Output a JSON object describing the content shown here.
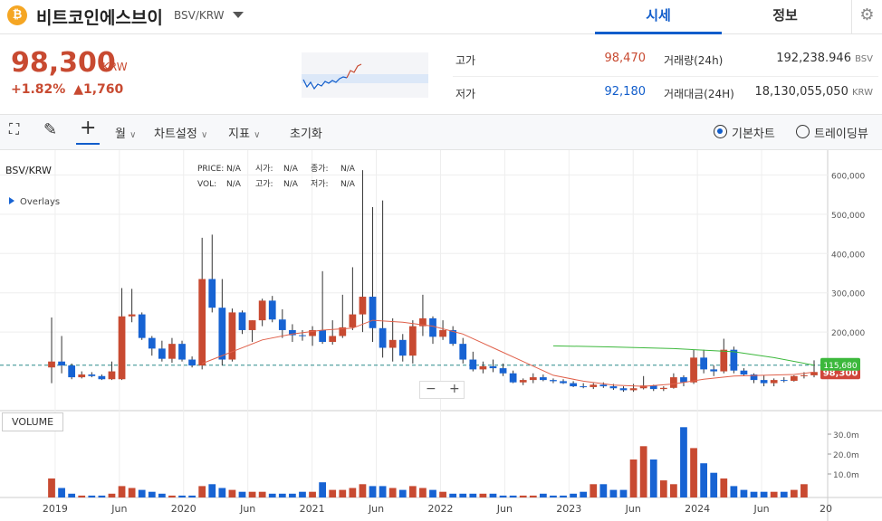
{
  "header": {
    "coin_icon": "₿",
    "coin_name": "비트코인에스브이",
    "pair": "BSV/KRW",
    "tabs": [
      {
        "label": "시세"
      },
      {
        "label": "정보"
      }
    ]
  },
  "price": {
    "current": "98,300",
    "unit": "KRW",
    "change_rate": "+1.82%",
    "change_amount": "▲1,760"
  },
  "stats": {
    "high_label": "고가",
    "high": "98,470",
    "low_label": "저가",
    "low": "92,180",
    "volume_label": "거래량(24h)",
    "volume": "192,238.946",
    "volume_unit": "BSV",
    "value_label": "거래대금(24H)",
    "value": "18,130,055,050",
    "value_unit": "KRW"
  },
  "toolbar": {
    "period": "월",
    "chart_settings": "차트설정",
    "indicators": "지표",
    "reset": "초기화",
    "basic_chart": "기본차트",
    "trading_view": "트레이딩뷰"
  },
  "chart_data": {
    "type": "candlestick",
    "title": "BSV/KRW",
    "overlays_label": "Overlays",
    "info": {
      "price_label": "PRICE:",
      "price": "N/A",
      "open_label": "시가:",
      "open": "N/A",
      "close_label": "종가:",
      "close": "N/A",
      "vol_label": "VOL:",
      "vol": "N/A",
      "high_label": "고가:",
      "high": "N/A",
      "low_label": "저가:",
      "low": "N/A"
    },
    "y_ticks": [
      "600,000",
      "500,000",
      "400,000",
      "300,000",
      "200,000"
    ],
    "y_values": [
      600000,
      500000,
      400000,
      300000,
      200000
    ],
    "ylim": [
      0,
      640000
    ],
    "x_ticks": [
      "Jun",
      "2019",
      "Jun",
      "2020",
      "Jun",
      "2021",
      "Jun",
      "2022",
      "Jun",
      "2023",
      "Jun",
      "2024",
      "Jun",
      "20"
    ],
    "volume_ticks": [
      "30.0m",
      "20.0m",
      "10.0m"
    ],
    "volume_label": "VOLUME",
    "current_price_tag": "98,300",
    "ma_tag": "115,680",
    "candles": [
      [
        110000,
        237000,
        70000,
        125000
      ],
      [
        125000,
        190000,
        95000,
        115000
      ],
      [
        115000,
        120000,
        80000,
        85000
      ],
      [
        85000,
        100000,
        82000,
        92000
      ],
      [
        92000,
        98000,
        85000,
        88000
      ],
      [
        88000,
        92000,
        78000,
        80000
      ],
      [
        80000,
        125000,
        78000,
        100000
      ],
      [
        80000,
        312000,
        78000,
        240000
      ],
      [
        240000,
        310000,
        225000,
        245000
      ],
      [
        245000,
        250000,
        180000,
        185000
      ],
      [
        185000,
        190000,
        140000,
        158000
      ],
      [
        158000,
        178000,
        125000,
        132000
      ],
      [
        132000,
        185000,
        122000,
        170000
      ],
      [
        170000,
        178000,
        125000,
        130000
      ],
      [
        130000,
        138000,
        110000,
        115000
      ],
      [
        115000,
        440000,
        105000,
        335000
      ],
      [
        335000,
        448000,
        250000,
        262000
      ],
      [
        262000,
        335000,
        115000,
        130000
      ],
      [
        130000,
        260000,
        125000,
        250000
      ],
      [
        250000,
        255000,
        195000,
        205000
      ],
      [
        205000,
        230000,
        175000,
        230000
      ],
      [
        230000,
        285000,
        215000,
        280000
      ],
      [
        280000,
        292000,
        225000,
        232000
      ],
      [
        232000,
        258000,
        185000,
        205000
      ],
      [
        205000,
        220000,
        175000,
        192000
      ],
      [
        192000,
        205000,
        178000,
        190000
      ],
      [
        190000,
        215000,
        165000,
        205000
      ],
      [
        205000,
        355000,
        170000,
        175000
      ],
      [
        175000,
        230000,
        168000,
        190000
      ],
      [
        190000,
        295000,
        185000,
        212000
      ],
      [
        212000,
        365000,
        205000,
        245000
      ],
      [
        245000,
        612000,
        200000,
        290000
      ],
      [
        290000,
        518000,
        175000,
        210000
      ],
      [
        210000,
        535000,
        135000,
        160000
      ],
      [
        160000,
        235000,
        125000,
        180000
      ],
      [
        180000,
        195000,
        125000,
        140000
      ],
      [
        140000,
        230000,
        120000,
        215000
      ],
      [
        215000,
        295000,
        190000,
        235000
      ],
      [
        235000,
        240000,
        170000,
        188000
      ],
      [
        188000,
        230000,
        180000,
        205000
      ],
      [
        205000,
        215000,
        165000,
        170000
      ],
      [
        170000,
        185000,
        120000,
        130000
      ],
      [
        130000,
        150000,
        100000,
        105000
      ],
      [
        105000,
        125000,
        95000,
        113000
      ],
      [
        113000,
        130000,
        98000,
        108000
      ],
      [
        108000,
        120000,
        88000,
        95000
      ],
      [
        95000,
        102000,
        70000,
        72000
      ],
      [
        72000,
        82000,
        65000,
        78000
      ],
      [
        78000,
        95000,
        70000,
        85000
      ],
      [
        85000,
        92000,
        75000,
        78000
      ],
      [
        78000,
        82000,
        70000,
        75000
      ],
      [
        75000,
        80000,
        68000,
        70000
      ],
      [
        70000,
        75000,
        60000,
        62000
      ],
      [
        62000,
        70000,
        57000,
        60000
      ],
      [
        60000,
        70000,
        55000,
        66000
      ],
      [
        66000,
        72000,
        58000,
        62000
      ],
      [
        62000,
        68000,
        53000,
        57000
      ],
      [
        57000,
        62000,
        48000,
        52000
      ],
      [
        52000,
        68000,
        48000,
        57000
      ],
      [
        57000,
        88000,
        54000,
        64000
      ],
      [
        64000,
        66000,
        50000,
        55000
      ],
      [
        55000,
        62000,
        50000,
        58000
      ],
      [
        58000,
        95000,
        56000,
        85000
      ],
      [
        85000,
        90000,
        62000,
        72000
      ],
      [
        72000,
        155000,
        68000,
        135000
      ],
      [
        135000,
        155000,
        95000,
        105000
      ],
      [
        105000,
        115000,
        88000,
        100000
      ],
      [
        100000,
        183000,
        95000,
        155000
      ],
      [
        155000,
        163000,
        95000,
        102000
      ],
      [
        102000,
        108000,
        88000,
        92000
      ],
      [
        92000,
        95000,
        70000,
        78000
      ],
      [
        78000,
        90000,
        62000,
        70000
      ],
      [
        70000,
        82000,
        62000,
        78000
      ],
      [
        78000,
        85000,
        72000,
        76000
      ],
      [
        76000,
        90000,
        74000,
        88000
      ],
      [
        88000,
        98000,
        82000,
        90000
      ],
      [
        90000,
        128000,
        85000,
        98300
      ]
    ],
    "ma_series": [
      {
        "x": 15,
        "y": 120000
      },
      {
        "x": 18,
        "y": 150000
      },
      {
        "x": 21,
        "y": 180000
      },
      {
        "x": 24,
        "y": 195000
      },
      {
        "x": 27,
        "y": 205000
      },
      {
        "x": 30,
        "y": 210000
      },
      {
        "x": 32,
        "y": 230000
      },
      {
        "x": 35,
        "y": 225000
      },
      {
        "x": 38,
        "y": 215000
      },
      {
        "x": 41,
        "y": 195000
      },
      {
        "x": 44,
        "y": 160000
      },
      {
        "x": 47,
        "y": 125000
      },
      {
        "x": 50,
        "y": 90000
      },
      {
        "x": 53,
        "y": 75000
      },
      {
        "x": 56,
        "y": 65000
      },
      {
        "x": 59,
        "y": 62000
      },
      {
        "x": 62,
        "y": 68000
      },
      {
        "x": 65,
        "y": 80000
      },
      {
        "x": 68,
        "y": 88000
      },
      {
        "x": 71,
        "y": 90000
      },
      {
        "x": 74,
        "y": 92000
      },
      {
        "x": 76,
        "y": 98000
      }
    ],
    "ma2_series": [
      {
        "x": 50,
        "y": 165000
      },
      {
        "x": 56,
        "y": 162000
      },
      {
        "x": 62,
        "y": 158000
      },
      {
        "x": 68,
        "y": 150000
      },
      {
        "x": 72,
        "y": 135000
      },
      {
        "x": 76,
        "y": 115680
      }
    ],
    "volumes": [
      10,
      5,
      2,
      1,
      1,
      1,
      2,
      6,
      5,
      4,
      3,
      2,
      1,
      1,
      1,
      6,
      7,
      5,
      4,
      3,
      3,
      3,
      2,
      2,
      2,
      3,
      3,
      8,
      4,
      4,
      5,
      7,
      6,
      6,
      5,
      4,
      6,
      5,
      4,
      3,
      2,
      2,
      2,
      2,
      2,
      1,
      1,
      1,
      1,
      2,
      1,
      1,
      2,
      3,
      7,
      7,
      4,
      4,
      20,
      27,
      20,
      9,
      7,
      37,
      26,
      18,
      13,
      10,
      6,
      4,
      3,
      3,
      3,
      3,
      4,
      7
    ]
  }
}
